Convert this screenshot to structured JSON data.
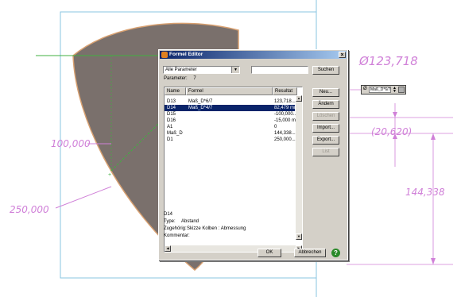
{
  "colors": {
    "part_fill": "#7a706c",
    "part_outline": "#d8a070",
    "dimension": "#d080d8",
    "frame": "#88c4e0",
    "titlebar": "#0a246a",
    "selection": "#0a246a"
  },
  "cad": {
    "dim_diameter": "Ø123,718",
    "dim_left": "100,000",
    "dim_bottom_left": "250,000",
    "dim_right_paren": "(20,620)",
    "dim_right_vertical": "144,338"
  },
  "formula_field": {
    "symbol": "Ø",
    "value": "Maß_D*6/7"
  },
  "dialog": {
    "title": "Formel Editor",
    "close": "×",
    "filter_value": "Alle Parameter",
    "parameter_label": "Parameter:",
    "parameter_count": "7",
    "buttons": {
      "search": "Suchen",
      "new": "Neu...",
      "change": "Ändern",
      "delete": "Löschen",
      "import": "Import...",
      "export": "Export...",
      "list": "List",
      "ok": "OK",
      "cancel": "Abbrechen"
    },
    "columns": [
      "Name",
      "Formel",
      "Resultat"
    ],
    "rows": [
      {
        "name": "D13",
        "formula": "Maß_D*6/7",
        "result": "123,718..."
      },
      {
        "name": "D14",
        "formula": "Maß_D*4/7",
        "result": "82,479 mm"
      },
      {
        "name": "D15",
        "formula": "",
        "result": "-100,000..."
      },
      {
        "name": "D16",
        "formula": "",
        "result": "-15,000 mm"
      },
      {
        "name": "A1",
        "formula": "",
        "result": "0"
      },
      {
        "name": "Maß_D",
        "formula": "",
        "result": "144,338..."
      },
      {
        "name": "D1",
        "formula": "",
        "result": "250,000..."
      }
    ],
    "selected_row": 1,
    "info": {
      "name": "D14",
      "type_label": "Type:",
      "type_value": "Abstand",
      "belongs_label": "Zugehörig:",
      "belongs_value": "Skizze Kolben : Abmessung",
      "comment_label": "Kommentar:"
    },
    "help_icon": "?"
  }
}
